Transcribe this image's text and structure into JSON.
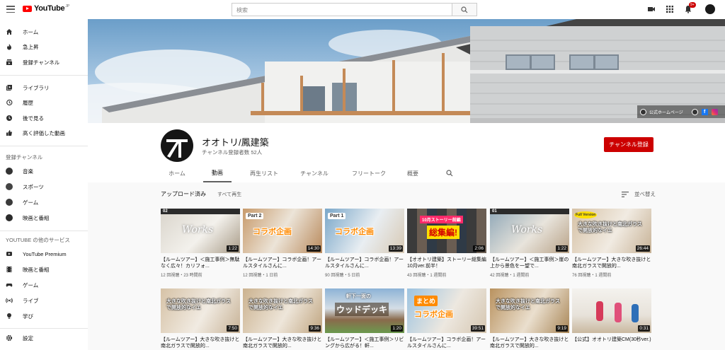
{
  "topbar": {
    "logo_text": "YouTube",
    "logo_superscript": "JP",
    "search_placeholder": "検索",
    "notification_count": "9+",
    "icons": [
      "menu-icon",
      "search-icon",
      "create-video-icon",
      "apps-icon",
      "notifications-icon"
    ]
  },
  "sidebar": {
    "primary": [
      {
        "label": "ホーム",
        "icon": "home-icon"
      },
      {
        "label": "急上昇",
        "icon": "trending-icon"
      },
      {
        "label": "登録チャンネル",
        "icon": "subscriptions-icon"
      }
    ],
    "library": [
      {
        "label": "ライブラリ",
        "icon": "library-icon"
      },
      {
        "label": "履歴",
        "icon": "history-icon"
      },
      {
        "label": "後で見る",
        "icon": "watch-later-icon"
      },
      {
        "label": "高く評価した動画",
        "icon": "like-icon"
      }
    ],
    "subscriptions_heading": "登録チャンネル",
    "subscriptions": [
      {
        "label": "音楽",
        "icon": "music-icon"
      },
      {
        "label": "スポーツ",
        "icon": "sports-icon"
      },
      {
        "label": "ゲーム",
        "icon": "gaming-icon"
      },
      {
        "label": "映画と番組",
        "icon": "movies-icon"
      }
    ],
    "more_heading": "YOUTUBE の他のサービス",
    "more": [
      {
        "label": "YouTube Premium",
        "icon": "premium-icon"
      },
      {
        "label": "映画と番組",
        "icon": "movies-icon"
      },
      {
        "label": "ゲーム",
        "icon": "gaming-icon"
      },
      {
        "label": "ライブ",
        "icon": "live-icon"
      },
      {
        "label": "学び",
        "icon": "learning-icon"
      }
    ],
    "settings": {
      "label": "設定",
      "icon": "settings-icon"
    }
  },
  "banner": {
    "link_label": "公式ホームページ",
    "links": [
      "website-icon",
      "facebook-icon",
      "instagram-icon"
    ]
  },
  "channel": {
    "name": "オオトリ/鳳建築",
    "subscribers": "チャンネル登録者数 52人",
    "subscribe_label": "チャンネル登録",
    "tabs": [
      "ホーム",
      "動画",
      "再生リスト",
      "チャンネル",
      "フリートーク",
      "概要"
    ],
    "active_tab": "動画"
  },
  "uploads": {
    "heading": "アップロード済み",
    "play_all": "すべて再生",
    "sort_label": "並べ替え"
  },
  "videos_row1": [
    {
      "title": "【ルームツアー】＜施工事例＞無駄なく広々！カリフォ...",
      "meta": "12 回視聴・23 時間前",
      "duration": "1:22",
      "thumb_text": "Works",
      "badge": "02"
    },
    {
      "title": "【ルームツアー】コラボ企画！アールスタイルさんに...",
      "meta": "12 回視聴・1 日前",
      "duration": "14:30",
      "thumb_text": "コラボ企画",
      "badge": "Part 2"
    },
    {
      "title": "【ルームツアー】コラボ企画！アールスタイルさんに...",
      "meta": "90 回視聴・5 日前",
      "duration": "13:39",
      "thumb_text": "コラボ企画",
      "badge": "Part 1"
    },
    {
      "title": "【オオトリ建築】ストーリー総集編10月ver.前半！",
      "meta": "43 回視聴・1 週間前",
      "duration": "2:06",
      "thumb_text": "総集編!",
      "badge": "10月ストーリー前編"
    },
    {
      "title": "【ルームツアー】＜施工事例＞崖の上から景色を一望で...",
      "meta": "42 回視聴・1 週間前",
      "duration": "1:22",
      "thumb_text": "Works",
      "badge": "01"
    },
    {
      "title": "【ルームツアー】大きな吹き抜けと南北ガラスで開放的...",
      "meta": "76 回視聴・1 週間前",
      "duration": "26:44",
      "thumb_text": "大きな吹き抜けと南北ガラスで開放的なイエ",
      "badge": "Full Version"
    }
  ],
  "videos_row2": [
    {
      "title": "【ルームツアー】大きな吹き抜けと南北ガラスで開放的...",
      "duration": "7:50",
      "thumb_text": "大きな吹き抜けと南北ガラスで開放的なイエ"
    },
    {
      "title": "【ルームツアー】大きな吹き抜けと南北ガラスで開放的...",
      "duration": "9:36",
      "thumb_text": "大きな吹き抜けと南北ガラスで開放的なイエ"
    },
    {
      "title": "【ルームツアー】＜施工事例＞リビングから広がる！軒...",
      "duration": "1:20",
      "thumb_text": "ウッドデッキ",
      "badge": "軒下一面の"
    },
    {
      "title": "【ルームツアー】コラボ企画！アールスタイルさんに...",
      "duration": "39:51",
      "thumb_text": "コラボ企画",
      "badge": "まとめ"
    },
    {
      "title": "【ルームツアー】大きな吹き抜けと南北ガラスで開放的...",
      "duration": "9:19",
      "thumb_text": "大きな吹き抜けと南北ガラスで開放的なイエ"
    },
    {
      "title": "【公式】オオトリ建築CM(30秒ver.)",
      "duration": "0:31",
      "thumb_text": ""
    }
  ],
  "colors": {
    "accent_red": "#cc0000",
    "youtube_red": "#ff0000"
  }
}
